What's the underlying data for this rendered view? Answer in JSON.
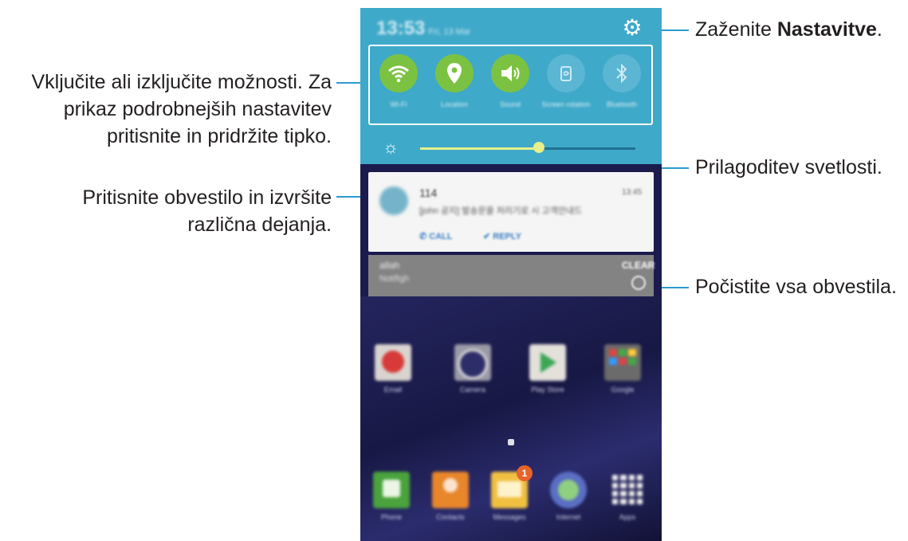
{
  "callouts": {
    "settings_prefix": "Zaženite ",
    "settings_bold": "Nastavitve",
    "settings_suffix": ".",
    "toggles_line1": "Vključite ali izključite možnosti. Za",
    "toggles_line2": "prikaz podrobnejših nastavitev",
    "toggles_line3": "pritisnite in pridržite tipko.",
    "brightness": "Prilagoditev svetlosti.",
    "notification_line1": "Pritisnite obvestilo in izvršite",
    "notification_line2": "različna dejanja.",
    "clear": "Počistite vsa obvestila."
  },
  "phone": {
    "status": {
      "time": "13:53",
      "date": "Fri, 13 Mar"
    },
    "toggles": [
      {
        "label": "Wi-Fi",
        "icon": "wifi-icon",
        "state": "on"
      },
      {
        "label": "Location",
        "icon": "location-pin-icon",
        "state": "on"
      },
      {
        "label": "Sound",
        "icon": "speaker-icon",
        "state": "on"
      },
      {
        "label": "Screen rotation",
        "icon": "screen-rotation-icon",
        "state": "off"
      },
      {
        "label": "Bluetooth",
        "icon": "bluetooth-icon",
        "state": "off"
      }
    ],
    "brightness_level": 0.55,
    "notification": {
      "title": "114",
      "time": "13:45",
      "text": "[john 공지] 발송문을 처리기로 시 고객안내드",
      "action_call": "CALL",
      "action_reply": "REPLY"
    },
    "bar2": {
      "line1": "allah",
      "line2": "Notifigh",
      "clear": "CLEAR"
    },
    "apps_row1": [
      "Email",
      "Camera",
      "Play Store",
      "Google"
    ],
    "apps_row2": [
      "Phone",
      "Contacts",
      "Messages",
      "Internet",
      "Apps"
    ],
    "messages_badge": "1"
  },
  "colors": {
    "accent_line": "#2a9bcf",
    "panel": "#3fa9c9",
    "toggle_on": "#7cc242"
  }
}
